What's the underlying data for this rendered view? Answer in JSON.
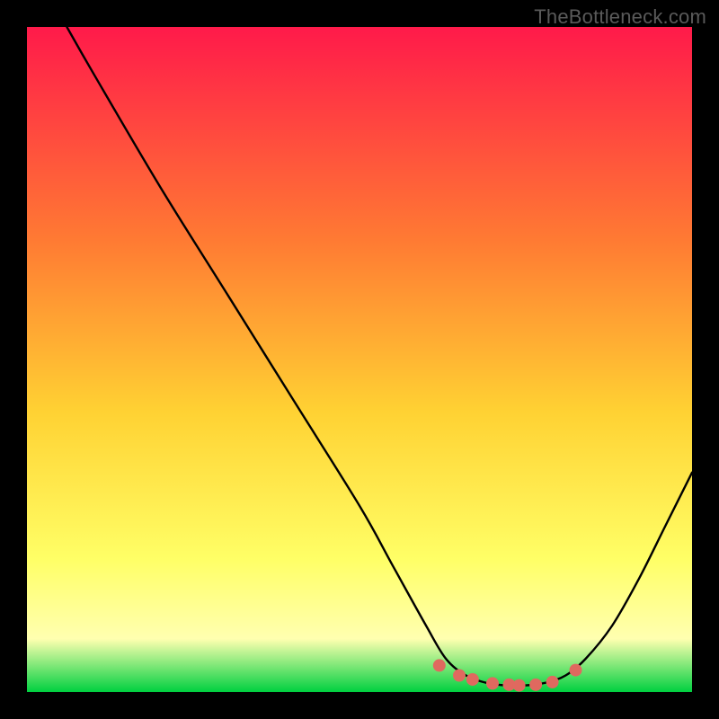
{
  "watermark": "TheBottleneck.com",
  "chart_data": {
    "type": "line",
    "title": "",
    "xlabel": "",
    "ylabel": "",
    "xlim": [
      0,
      100
    ],
    "ylim": [
      0,
      100
    ],
    "grid": false,
    "legend": false,
    "gradient_colors": {
      "top": "#ff1a4a",
      "mid_upper": "#ff7a33",
      "mid": "#ffd233",
      "mid_lower": "#ffff66",
      "lower": "#ffffb0",
      "bottom": "#00d040"
    },
    "curve": {
      "stroke": "#000000",
      "points_xy": [
        [
          6,
          100
        ],
        [
          10,
          93
        ],
        [
          20,
          76
        ],
        [
          30,
          60
        ],
        [
          40,
          44
        ],
        [
          50,
          28
        ],
        [
          55,
          19
        ],
        [
          60,
          10
        ],
        [
          63,
          5
        ],
        [
          66,
          2.5
        ],
        [
          69,
          1.4
        ],
        [
          72,
          1.0
        ],
        [
          75,
          1.0
        ],
        [
          78,
          1.4
        ],
        [
          81,
          2.5
        ],
        [
          84,
          5
        ],
        [
          88,
          10
        ],
        [
          92,
          17
        ],
        [
          96,
          25
        ],
        [
          100,
          33
        ]
      ]
    },
    "markers": {
      "color": "#e0695f",
      "radius_px": 7,
      "points_xy": [
        [
          62,
          4.0
        ],
        [
          65,
          2.5
        ],
        [
          67,
          1.9
        ],
        [
          70,
          1.3
        ],
        [
          72.5,
          1.1
        ],
        [
          74,
          1.0
        ],
        [
          76.5,
          1.1
        ],
        [
          79,
          1.5
        ],
        [
          82.5,
          3.3
        ]
      ]
    }
  }
}
